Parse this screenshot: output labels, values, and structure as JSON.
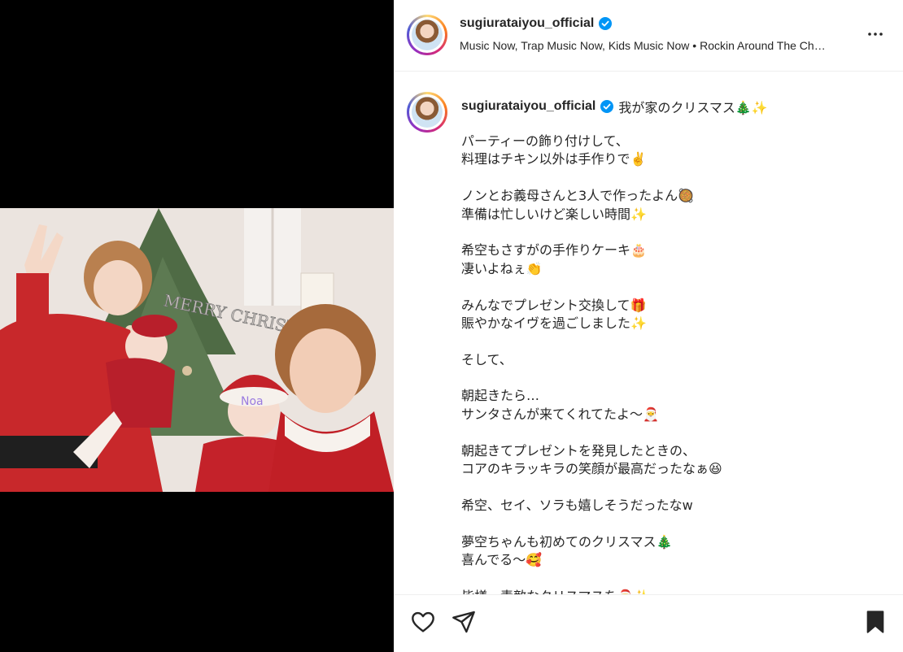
{
  "post": {
    "username": "sugiurataiyou_official",
    "audio_line": "Music Now, Trap Music Now, Kids Music Now • Rockin Around The Ch…",
    "more_icon": "more-horizontal-icon"
  },
  "caption": {
    "username": "sugiurataiyou_official",
    "first_line": "我が家のクリスマス🎄✨",
    "lines": [
      "パーティーの飾り付けして、",
      "料理はチキン以外は手作りで✌️",
      "",
      "ノンとお義母さんと3人で作ったよん🥘",
      "準備は忙しいけど楽しい時間✨",
      "",
      "希空もさすがの手作りケーキ🎂",
      "凄いよねぇ👏",
      "",
      "みんなでプレゼント交換して🎁",
      "賑やかなイヴを過ごしました✨",
      "",
      "そして、",
      "",
      "朝起きたら…",
      "サンタさんが来てくれてたよ〜🎅",
      "",
      "朝起きてプレゼントを発見したときの、",
      "コアのキラッキラの笑顔が最高だったなぁ😆",
      "",
      "希空、セイ、ソラも嬉しそうだったなw",
      "",
      "夢空ちゃんも初めてのクリスマス🎄",
      "喜んでる〜🥰",
      "",
      "皆様、素敵なクリスマスを🎅✨"
    ]
  },
  "photo": {
    "sign_text": "MERRY CHRISTMAS",
    "headband_text": "Noa"
  },
  "actions": {
    "like_icon": "heart-icon",
    "share_icon": "send-icon",
    "save_icon": "bookmark-icon"
  },
  "colors": {
    "verified": "#0095f6",
    "text": "#262626",
    "divider": "#efefef"
  }
}
